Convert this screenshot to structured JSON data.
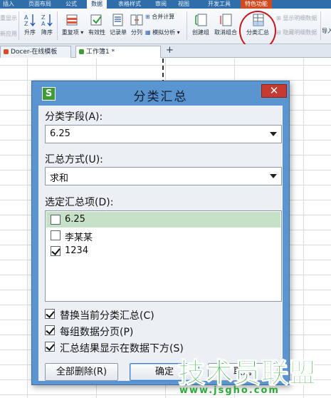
{
  "menu": {
    "tabs": [
      "插入",
      "页面布局",
      "公式",
      "数据",
      "表格样式",
      "审阅",
      "视图",
      "开发工具",
      "特色功能"
    ],
    "active": "数据",
    "special": "特色功能"
  },
  "ribbon": {
    "left_fragments": [
      "重显示",
      "新应用"
    ],
    "sort_asc": "升序",
    "sort_desc": "降序",
    "duplicates": "重复项",
    "validity": "有效性",
    "record_form": "记录单",
    "split": "分列",
    "consolidate": "合并计算",
    "what_if": "模拟分析",
    "create_group": "创建组",
    "ungroup": "取消组合",
    "subtotal": "分类汇总",
    "show_detail": "显示明细数据",
    "hide_detail": "隐藏明细数据",
    "import_fragment": "导入"
  },
  "doc_tabs": [
    {
      "label": "Docer-在线模板",
      "color": "#d94c2b"
    },
    {
      "label": "工作簿1 *",
      "color": "#3f9a3a"
    }
  ],
  "dialog": {
    "app_icon": "S",
    "title": "分类汇总",
    "close": "✕",
    "field_label": "分类字段(A):",
    "field_value": "6.25",
    "method_label": "汇总方式(U):",
    "method_value": "求和",
    "items_label": "选定汇总项(D):",
    "items": [
      {
        "label": "6.25",
        "checked": false,
        "selected": true
      },
      {
        "label": "李某某",
        "checked": false,
        "selected": false
      },
      {
        "label": "1234",
        "checked": true,
        "selected": false
      }
    ],
    "options": [
      {
        "label": "替换当前分类汇总(C)",
        "checked": true
      },
      {
        "label": "每组数据分页(P)",
        "checked": true
      },
      {
        "label": "汇总结果显示在数据下方(S)",
        "checked": true
      }
    ],
    "remove_all": "全部删除(R)",
    "ok": "确定",
    "cancel": "取消"
  },
  "watermark": {
    "main": "技术员联盟",
    "url": "www.jsgho.com"
  },
  "colors": {
    "dialog_frame": "#5b95cf",
    "close_button": "#c73a2f",
    "selected_row": "#c7e1c7",
    "highlight_circle": "#c4161c",
    "watermark": "#2fa83a"
  }
}
